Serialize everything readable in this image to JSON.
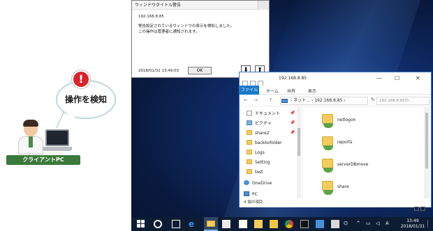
{
  "illustration": {
    "bubble_text": "操作を検知",
    "alert_symbol": "!",
    "client_label": "クライアントPC"
  },
  "warning_dialog": {
    "title": "ウィンドウタイトル警告",
    "ip": "192.168.8.85",
    "message_line1": "警告設定されているウィンドウの表示を検知しました。",
    "message_line2": "この操作は管理者に通知されます。",
    "timestamp": "2018/01/31 13:49:03",
    "ok_label": "OK",
    "down_arrow": "⬇",
    "up_arrow": "⬆"
  },
  "explorer": {
    "title": "192.168.8.85",
    "minimize": "—",
    "maximize": "☐",
    "close": "✕",
    "ribbon": {
      "file": "ファイル",
      "home": "ホーム",
      "share": "共有",
      "view": "表示"
    },
    "address": {
      "back": "←",
      "forward": "→",
      "up": "↑",
      "path": "› ネット... › 192.168.8.85 ›",
      "dropdown": "⌄",
      "refresh": "↻",
      "search_placeholder": "192.168.8.85の..."
    },
    "nav_items": [
      {
        "label": "ドキュメント",
        "icon": "document-icon",
        "pinned": true
      },
      {
        "label": "ピクチャ",
        "icon": "pictures-icon",
        "pinned": true
      },
      {
        "label": "share2",
        "icon": "folder-icon",
        "pinned": true
      },
      {
        "label": "backkofolder",
        "icon": "folder-icon",
        "pinned": false
      },
      {
        "label": "Logs",
        "icon": "folder-icon",
        "pinned": false
      },
      {
        "label": "Setting",
        "icon": "folder-icon",
        "pinned": false
      },
      {
        "label": "test",
        "icon": "folder-icon",
        "pinned": false
      },
      {
        "label": "OneDrive",
        "icon": "onedrive-icon",
        "pinned": false
      },
      {
        "label": "PC",
        "icon": "pc-icon",
        "pinned": false
      }
    ],
    "pin_glyph": "📌",
    "shares": [
      "netlogon",
      "reports",
      "serverDBmove",
      "share"
    ],
    "status_text": "4 個の項目"
  },
  "taskbar": {
    "edge_glyph": "e",
    "tray": {
      "people": "⌬",
      "chevron": "^",
      "network": "▭",
      "volume": "◁",
      "ime": "A"
    },
    "time": "13:49",
    "date": "2018/01/31"
  },
  "colors": {
    "accent": "#1979ca",
    "alert": "#d8232a",
    "client_label_bg": "#3b7a3a",
    "folder": "#f3cc5b",
    "desktop": "#0f2c6a"
  }
}
